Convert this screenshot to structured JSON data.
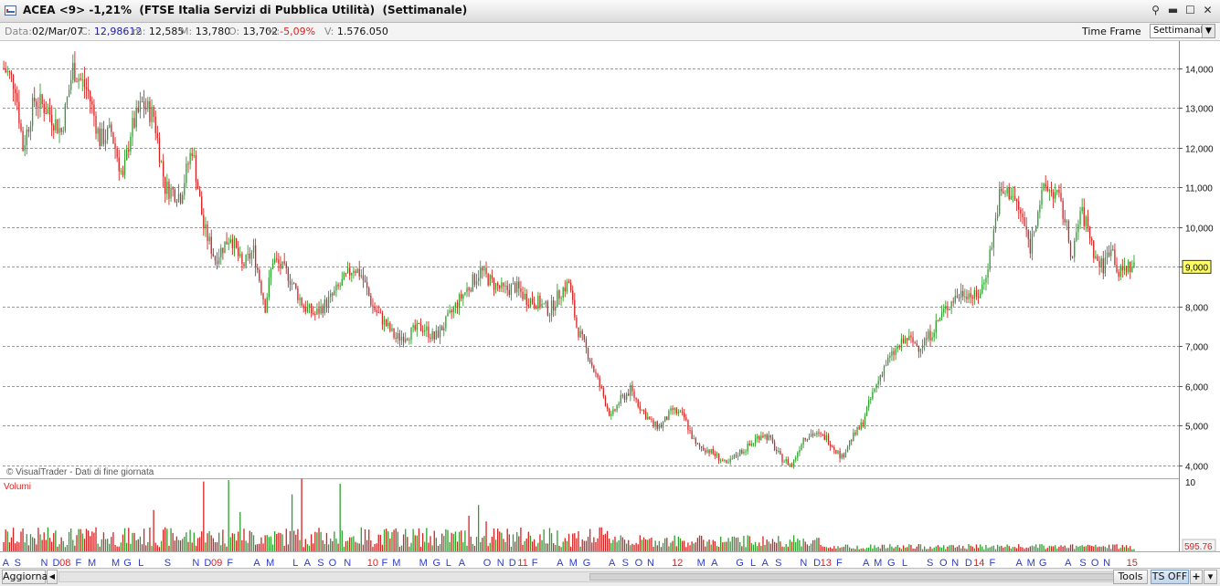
{
  "window": {
    "title": "ACEA <9> -1,21%  (FTSE Italia Servizi di Pubblica Utilità)  (Settimanale)"
  },
  "info": {
    "data_label": "Data:",
    "data_value": "02/Mar/07",
    "close_label": "C:",
    "close_value": "12,98612",
    "min_label": "m:",
    "min_value": "12,585",
    "max_label": "M:",
    "max_value": "13,780",
    "open_label": "O:",
    "open_value": "13,702",
    "pct_label": "%:",
    "pct_value": "-5,09%",
    "vol_label": "V:",
    "vol_value": "1.576.050",
    "timeframe_label": "Time Frame",
    "timeframe_value": "Settimanale"
  },
  "colors": {
    "up": "#2ca02c",
    "down": "#d62222",
    "grid": "#9a9a9a",
    "axis_blue": "#2a3bd4",
    "axis_red": "#d62222",
    "highlight": "#ffff66"
  },
  "chart_data": {
    "type": "candlestick",
    "title": "ACEA <9> -1,21%  (FTSE Italia Servizi di Pubblica Utilità)  (Settimanale)",
    "watermark": "© VisualTrader - Dati di fine giornata",
    "price_axis": {
      "ylim": [
        3.7,
        14.5
      ],
      "ticks": [
        "14,000",
        "13,000",
        "12,000",
        "11,000",
        "10,000",
        "9,000",
        "8,000",
        "7,000",
        "6,000",
        "5,000",
        "4,000"
      ]
    },
    "last_price_label": "9,000",
    "last_price": 9.0,
    "volume_panel": {
      "label": "Volumi",
      "top_label": "10",
      "bottom_label": "595.76"
    },
    "price_anchors": [
      [
        0,
        14.0
      ],
      [
        6,
        13.6
      ],
      [
        10,
        12.0
      ],
      [
        16,
        13.2
      ],
      [
        22,
        13.0
      ],
      [
        30,
        12.4
      ],
      [
        36,
        14.0
      ],
      [
        44,
        13.4
      ],
      [
        50,
        12.2
      ],
      [
        56,
        12.4
      ],
      [
        62,
        11.2
      ],
      [
        66,
        12.4
      ],
      [
        72,
        13.1
      ],
      [
        78,
        12.8
      ],
      [
        84,
        11.0
      ],
      [
        92,
        10.8
      ],
      [
        98,
        12.0
      ],
      [
        104,
        10.0
      ],
      [
        110,
        9.2
      ],
      [
        118,
        9.8
      ],
      [
        124,
        9.0
      ],
      [
        130,
        9.4
      ],
      [
        136,
        8.0
      ],
      [
        140,
        9.2
      ],
      [
        148,
        8.8
      ],
      [
        156,
        8.0
      ],
      [
        162,
        7.8
      ],
      [
        170,
        8.2
      ],
      [
        176,
        8.6
      ],
      [
        182,
        9.0
      ],
      [
        186,
        8.8
      ],
      [
        192,
        8.0
      ],
      [
        198,
        7.6
      ],
      [
        204,
        7.2
      ],
      [
        210,
        7.3
      ],
      [
        218,
        7.5
      ],
      [
        224,
        7.2
      ],
      [
        230,
        7.6
      ],
      [
        236,
        8.1
      ],
      [
        242,
        8.5
      ],
      [
        248,
        8.9
      ],
      [
        254,
        8.6
      ],
      [
        260,
        8.4
      ],
      [
        266,
        8.5
      ],
      [
        272,
        8.2
      ],
      [
        278,
        8.1
      ],
      [
        284,
        7.9
      ],
      [
        290,
        8.4
      ],
      [
        294,
        8.6
      ],
      [
        298,
        7.5
      ],
      [
        304,
        6.8
      ],
      [
        310,
        6.0
      ],
      [
        316,
        5.2
      ],
      [
        320,
        5.6
      ],
      [
        326,
        5.9
      ],
      [
        332,
        5.4
      ],
      [
        338,
        5.0
      ],
      [
        342,
        5.0
      ],
      [
        348,
        5.4
      ],
      [
        354,
        5.2
      ],
      [
        360,
        4.5
      ],
      [
        366,
        4.4
      ],
      [
        372,
        4.2
      ],
      [
        376,
        4.0
      ],
      [
        382,
        4.3
      ],
      [
        388,
        4.5
      ],
      [
        394,
        4.8
      ],
      [
        398,
        4.7
      ],
      [
        404,
        4.2
      ],
      [
        410,
        4.0
      ],
      [
        416,
        4.7
      ],
      [
        420,
        4.8
      ],
      [
        428,
        4.7
      ],
      [
        436,
        4.2
      ],
      [
        440,
        4.6
      ],
      [
        446,
        5.0
      ],
      [
        452,
        5.8
      ],
      [
        458,
        6.5
      ],
      [
        464,
        6.9
      ],
      [
        470,
        7.2
      ],
      [
        476,
        7.0
      ],
      [
        482,
        7.3
      ],
      [
        488,
        7.8
      ],
      [
        494,
        8.2
      ],
      [
        500,
        8.4
      ],
      [
        506,
        8.2
      ],
      [
        510,
        8.6
      ],
      [
        514,
        9.6
      ],
      [
        518,
        10.8
      ],
      [
        524,
        10.9
      ],
      [
        530,
        10.2
      ],
      [
        534,
        9.5
      ],
      [
        538,
        10.5
      ],
      [
        542,
        11.0
      ],
      [
        548,
        10.8
      ],
      [
        552,
        10.2
      ],
      [
        556,
        9.2
      ],
      [
        560,
        10.4
      ],
      [
        564,
        10.0
      ],
      [
        568,
        9.2
      ],
      [
        572,
        9.0
      ],
      [
        576,
        9.6
      ],
      [
        580,
        8.8
      ],
      [
        584,
        9.0
      ],
      [
        588,
        9.0
      ]
    ],
    "x_axis_labels": [
      {
        "t": "A",
        "i": 2,
        "c": "b"
      },
      {
        "t": "S",
        "i": 10,
        "c": "b"
      },
      {
        "t": "N",
        "i": 28,
        "c": "b"
      },
      {
        "t": "D",
        "i": 36,
        "c": "b"
      },
      {
        "t": "08",
        "i": 42,
        "c": "r"
      },
      {
        "t": "F",
        "i": 51,
        "c": "b"
      },
      {
        "t": "M",
        "i": 60,
        "c": "b"
      },
      {
        "t": "M",
        "i": 76,
        "c": "b"
      },
      {
        "t": "G",
        "i": 84,
        "c": "b"
      },
      {
        "t": "L",
        "i": 93,
        "c": "b"
      },
      {
        "t": "S",
        "i": 111,
        "c": "b"
      },
      {
        "t": "N",
        "i": 130,
        "c": "b"
      },
      {
        "t": "D",
        "i": 138,
        "c": "b"
      },
      {
        "t": "09",
        "i": 144,
        "c": "r"
      },
      {
        "t": "F",
        "i": 153,
        "c": "b"
      },
      {
        "t": "A",
        "i": 171,
        "c": "b"
      },
      {
        "t": "M",
        "i": 180,
        "c": "b"
      },
      {
        "t": "L",
        "i": 197,
        "c": "b"
      },
      {
        "t": "A",
        "i": 205,
        "c": "b"
      },
      {
        "t": "S",
        "i": 214,
        "c": "b"
      },
      {
        "t": "O",
        "i": 222,
        "c": "b"
      },
      {
        "t": "N",
        "i": 232,
        "c": "b"
      },
      {
        "t": "10",
        "i": 249,
        "c": "r"
      },
      {
        "t": "F",
        "i": 257,
        "c": "b"
      },
      {
        "t": "M",
        "i": 265,
        "c": "b"
      },
      {
        "t": "M",
        "i": 283,
        "c": "b"
      },
      {
        "t": "G",
        "i": 292,
        "c": "b"
      },
      {
        "t": "L",
        "i": 300,
        "c": "b"
      },
      {
        "t": "A",
        "i": 309,
        "c": "b"
      },
      {
        "t": "O",
        "i": 326,
        "c": "b"
      },
      {
        "t": "N",
        "i": 335,
        "c": "b"
      },
      {
        "t": "D",
        "i": 343,
        "c": "b"
      },
      {
        "t": "11",
        "i": 350,
        "c": "r"
      },
      {
        "t": "F",
        "i": 358,
        "c": "b"
      },
      {
        "t": "A",
        "i": 375,
        "c": "b"
      },
      {
        "t": "M",
        "i": 384,
        "c": "b"
      },
      {
        "t": "G",
        "i": 393,
        "c": "b"
      },
      {
        "t": "A",
        "i": 410,
        "c": "b"
      },
      {
        "t": "S",
        "i": 419,
        "c": "b"
      },
      {
        "t": "O",
        "i": 428,
        "c": "b"
      },
      {
        "t": "N",
        "i": 436,
        "c": "b"
      },
      {
        "t": "12",
        "i": 454,
        "c": "r"
      },
      {
        "t": "M",
        "i": 470,
        "c": "b"
      },
      {
        "t": "A",
        "i": 479,
        "c": "b"
      },
      {
        "t": "G",
        "i": 496,
        "c": "b"
      },
      {
        "t": "L",
        "i": 505,
        "c": "b"
      },
      {
        "t": "A",
        "i": 513,
        "c": "b"
      },
      {
        "t": "S",
        "i": 522,
        "c": "b"
      },
      {
        "t": "N",
        "i": 539,
        "c": "b"
      },
      {
        "t": "D",
        "i": 548,
        "c": "b"
      },
      {
        "t": "13",
        "i": 554,
        "c": "r"
      },
      {
        "t": "F",
        "i": 563,
        "c": "b"
      },
      {
        "t": "A",
        "i": 581,
        "c": "b"
      },
      {
        "t": "M",
        "i": 589,
        "c": "b"
      },
      {
        "t": "G",
        "i": 598,
        "c": "b"
      },
      {
        "t": "L",
        "i": 607,
        "c": "b"
      },
      {
        "t": "S",
        "i": 624,
        "c": "b"
      },
      {
        "t": "O",
        "i": 633,
        "c": "b"
      },
      {
        "t": "N",
        "i": 641,
        "c": "b"
      },
      {
        "t": "D",
        "i": 650,
        "c": "b"
      },
      {
        "t": "14",
        "i": 657,
        "c": "r"
      },
      {
        "t": "F",
        "i": 666,
        "c": "b"
      },
      {
        "t": "A",
        "i": 684,
        "c": "b"
      },
      {
        "t": "M",
        "i": 692,
        "c": "b"
      },
      {
        "t": "G",
        "i": 700,
        "c": "b"
      },
      {
        "t": "A",
        "i": 717,
        "c": "b"
      },
      {
        "t": "S",
        "i": 727,
        "c": "b"
      },
      {
        "t": "O",
        "i": 735,
        "c": "b"
      },
      {
        "t": "N",
        "i": 743,
        "c": "b"
      },
      {
        "t": "15",
        "i": 760,
        "c": "r"
      }
    ],
    "x_axis_count": 762,
    "volume_spikes": [
      [
        135,
        0.98
      ],
      [
        152,
        1.0
      ],
      [
        194,
        0.8
      ],
      [
        200,
        1.02
      ],
      [
        227,
        0.95
      ],
      [
        159,
        0.55
      ],
      [
        101,
        0.58
      ],
      [
        320,
        0.65
      ],
      [
        325,
        0.42
      ],
      [
        313,
        0.5
      ]
    ]
  },
  "bottom": {
    "aggiorna": "Aggiorna",
    "tools": "Tools",
    "tsoff": "TS OFF",
    "plus": "+",
    "menu": "▾"
  }
}
